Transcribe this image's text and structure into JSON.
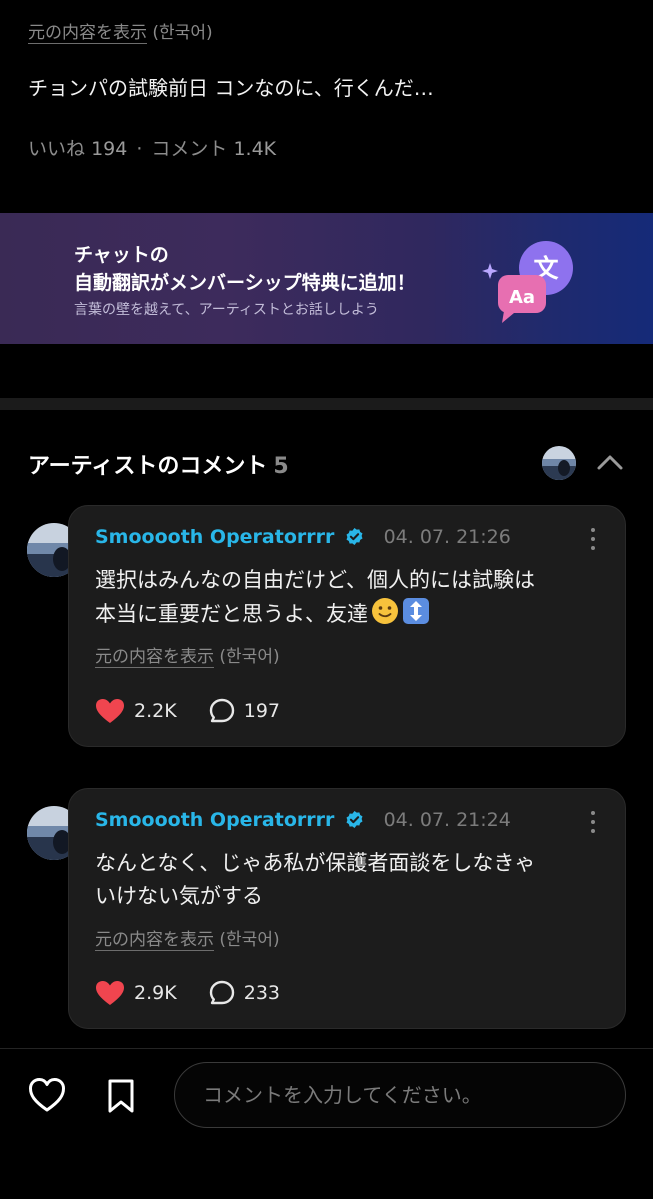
{
  "post": {
    "show_original": {
      "link": "元の内容を表示",
      "language": "(한국어)"
    },
    "text": "チョンパの試験前日 コンなのに、行くんだ…",
    "stats": {
      "likes_label": "いいね",
      "likes": "194",
      "separator": "·",
      "comments_label": "コメント",
      "comments": "1.4K"
    }
  },
  "banner": {
    "title_line1": "チャットの",
    "title_line2": "自動翻訳がメンバーシップ特典に追加！",
    "subtitle": "言葉の壁を越えて、アーティストとお話ししよう",
    "icon_text_1": "文",
    "icon_text_2": "Aa"
  },
  "artist_comments": {
    "title": "アーティストのコメント",
    "count": "5",
    "items": [
      {
        "author": "Smooooth Operatorrrr",
        "time": "04. 07. 21:26",
        "line1": "選択はみんなの自由だけど、個人的には試験は",
        "line2": "本当に重要だと思うよ、友達",
        "emojis": [
          "slightly-smiling-face",
          "up-down-arrow"
        ],
        "show_original": "元の内容を表示",
        "language": "(한국어)",
        "likes": "2.2K",
        "replies": "197"
      },
      {
        "author": "Smooooth Operatorrrr",
        "time": "04. 07. 21:24",
        "line1": "なんとなく、じゃあ私が保護者面談をしなきゃ",
        "line2": "いけない気がする",
        "show_original": "元の内容を表示",
        "language": "(한국어)",
        "likes": "2.9K",
        "replies": "233"
      }
    ]
  },
  "bottom_bar": {
    "input_placeholder": "コメントを入力してください。"
  },
  "colors": {
    "accent_blue": "#29b6e8",
    "heart_red": "#f0454f",
    "card_bg": "#1c1c1c"
  }
}
